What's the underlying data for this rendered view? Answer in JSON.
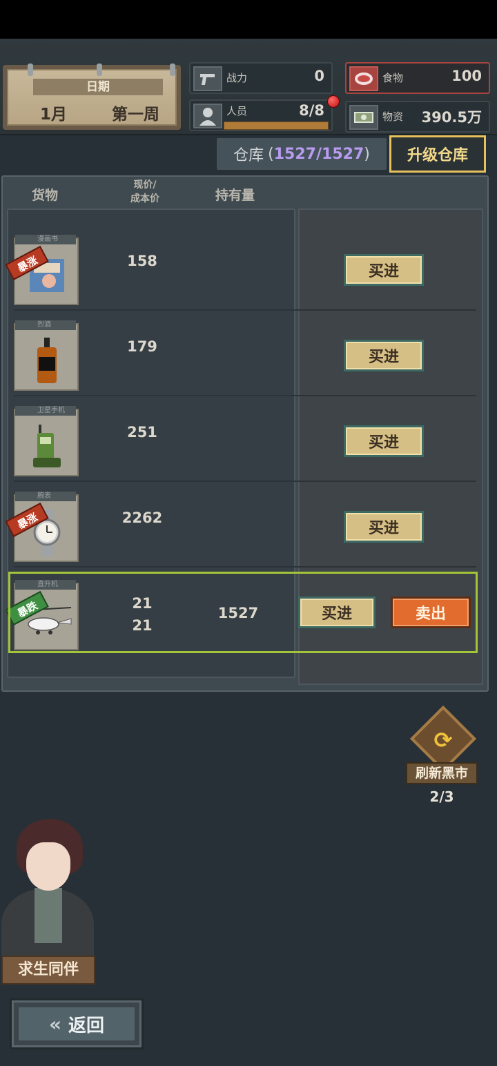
{
  "hud": {
    "date_label": "日期",
    "month": "1月",
    "week": "第一周",
    "power_label": "战力",
    "power_value": "0",
    "people_label": "人员",
    "people_value": "8/8",
    "food_label": "食物",
    "food_value": "100",
    "supplies_label": "物资",
    "supplies_value": "390.5万"
  },
  "warehouse": {
    "label": "仓库",
    "open": "(",
    "capacity": "1527/1527",
    "close": ")",
    "upgrade_label": "升级仓库"
  },
  "columns": {
    "goods": "货物",
    "price_line1": "现价/",
    "price_line2": "成本价",
    "holding": "持有量"
  },
  "items": [
    {
      "tag": "漫画书",
      "badge": "暴涨",
      "price": "158",
      "buy": "买进",
      "icon": "comic-book"
    },
    {
      "tag": "烈酒",
      "badge": "",
      "price": "179",
      "buy": "买进",
      "icon": "whiskey-bottle"
    },
    {
      "tag": "卫星手机",
      "badge": "",
      "price": "251",
      "buy": "买进",
      "icon": "satellite-phone"
    },
    {
      "tag": "腕表",
      "badge": "暴涨",
      "price": "2262",
      "buy": "买进",
      "icon": "wristwatch"
    },
    {
      "tag": "直升机",
      "badge": "暴跌",
      "price": "21",
      "cost": "21",
      "holding": "1527",
      "buy": "买进",
      "sell": "卖出",
      "icon": "gyrocopter"
    }
  ],
  "refresh": {
    "label": "刷新黑市",
    "count": "2/3"
  },
  "companion": {
    "label": "求生同伴"
  },
  "back": {
    "label": "返回"
  },
  "colors": {
    "accent_gold": "#e7c25b",
    "capacity_purple": "#b79cf0",
    "surge_red": "#b73a22",
    "drop_green": "#3f8f42",
    "sell_orange": "#e26c2e",
    "selected_green": "#a4c53a"
  }
}
